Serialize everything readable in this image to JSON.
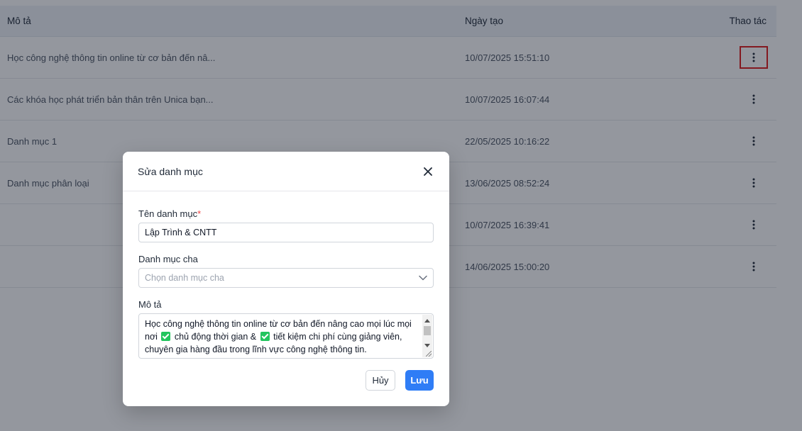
{
  "table": {
    "headers": {
      "description": "Mô tả",
      "created_at": "Ngày tạo",
      "actions": "Thao tác"
    },
    "rows": [
      {
        "description": "Học công nghệ thông tin online từ cơ bản đến nâ...",
        "created_at": "10/07/2025 15:51:10"
      },
      {
        "description": "Các khóa học phát triển bản thân trên Unica bạn...",
        "created_at": "10/07/2025 16:07:44"
      },
      {
        "description": "Danh mục 1",
        "created_at": "22/05/2025 10:16:22"
      },
      {
        "description": "Danh mục phân loại",
        "created_at": "13/06/2025 08:52:24"
      },
      {
        "description": "",
        "created_at": "10/07/2025 16:39:41"
      },
      {
        "description": "",
        "created_at": "14/06/2025 15:00:20"
      }
    ]
  },
  "modal": {
    "title": "Sửa danh mục",
    "name_label": "Tên danh mục",
    "required_mark": "*",
    "name_value": "Lập Trình & CNTT",
    "parent_label": "Danh mục cha",
    "parent_placeholder": "Chọn danh mục cha",
    "description_label": "Mô tả",
    "description_parts": {
      "line1": "Học công nghệ thông tin online từ cơ bản đến nâng cao mọi lúc mọi",
      "line2_a": "nơi",
      "line2_b": "chủ động thời gian &",
      "line2_c": "tiết kiệm chi phí cùng giảng viên,",
      "line3": "chuyên gia hàng đầu trong lĩnh vực công nghệ thông tin."
    },
    "cancel_label": "Hủy",
    "save_label": "Lưu"
  },
  "colors": {
    "primary": "#2f7df6",
    "highlight": "#e01b1b",
    "check": "#22c55e"
  },
  "icons": {
    "row_action": "kebab-vertical-icon",
    "close": "close-icon",
    "dropdown": "chevron-down-icon",
    "check": "check-box-icon"
  }
}
